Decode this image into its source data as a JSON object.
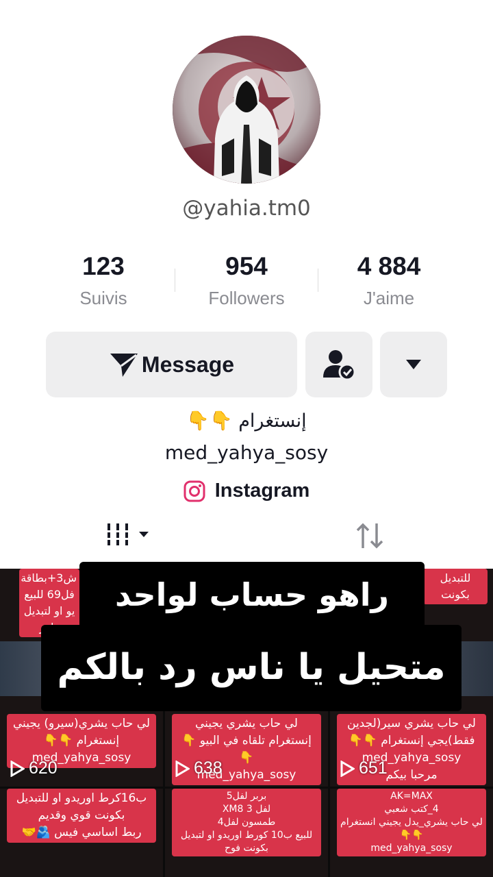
{
  "profile": {
    "username": "@yahia.tm0"
  },
  "stats": {
    "following": {
      "value": "123",
      "label": "Suivis"
    },
    "followers": {
      "value": "954",
      "label": "Followers"
    },
    "likes": {
      "value": "4 884",
      "label": "J'aime"
    }
  },
  "actions": {
    "message_label": "Message",
    "follow_icon": "user-check-icon",
    "more_icon": "chevron-down-icon"
  },
  "bio": {
    "line1": "إنستغرام 👇👇",
    "line2": "med_yahya_sosy",
    "link_label": "Instagram"
  },
  "tabs": {
    "videos_icon": "grid-icon",
    "reposts_icon": "repost-icon"
  },
  "overlay": {
    "line1": "راهو حساب لواحد",
    "line2": "متحيل يا ناس رد بالكم"
  },
  "videos": [
    {
      "caption_top": "ش3+بطاقة\nفل69 للبيع\nيو او لتبديل\nطور",
      "caption": "لي حاب يشري(سيرو) يجيني\nإنستغرام 👇👇\nmed_yahya_sosy",
      "views": "620"
    },
    {
      "caption": "لي حاب يشري يجيني\nإنستغرام تلقاه في البيو 👇👇\nmed_yahya_sosy",
      "views": "638"
    },
    {
      "caption_top": "للتبديل بكونت",
      "caption": "لي حاب يشري سير(لجدين\nفقط)يجي إنستغرام 👇👇\nmed_yahya_sosy\nمرحبا بيكم",
      "views": "651"
    },
    {
      "caption": "ب16كرط اوريدو او للتبديل\nبكونت قوي وقديم\nربط اساسي فيس 🫂🤝"
    },
    {
      "caption": "بربر لفل5\nلفل XM8 3\nطمسون لفل4\nللبيع ب10 كورط اوريدو او لتبديل\nبكونت فوح"
    },
    {
      "caption": "AK=MAX\n4_كتب شعبي\nلي حاب يشري_يدل يجيني انستغرام\n👇👇\nmed_yahya_sosy"
    }
  ],
  "colors": {
    "accent_red": "#d8344a",
    "button_bg": "#eeeeef",
    "instagram": "#e1306c"
  }
}
